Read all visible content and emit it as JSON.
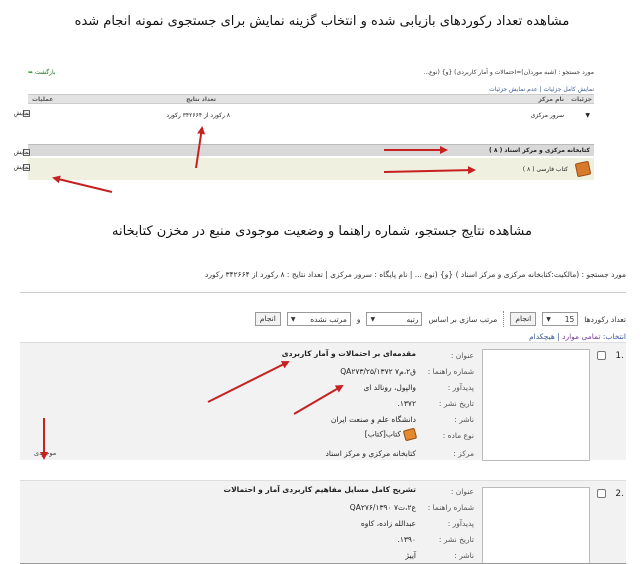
{
  "captions": {
    "top": "مشاهده تعداد رکوردهای بازیابی شده و انتخاب گزینه نمایش برای جستجوی نمونه انجام شده",
    "middle": "مشاهده نتایج جستجو، شماره راهنما و وضعیت موجودی منبع در مخزن کتابخانه"
  },
  "shot1": {
    "query": "مورد جستجو : (شبه مورد(ن)=احتمالات و آمار کاربردی) {و} (نوع...",
    "back": "بازگشت",
    "links": "نمایش کامل جزئیات | عدم نمایش جزئیات",
    "headers": {
      "details": "جزئیات",
      "center_name": "نام مرکز",
      "result_count": "تعداد نتایج",
      "actions": "عملیات"
    },
    "row1": {
      "center": "سرور مرکزی",
      "count": "۸ رکورد از ۳۴۲۶۶۴ رکورد",
      "action": "نمایش"
    },
    "group": {
      "title": "کتابخانه مرکزی و مرکز اسناد ( ۸ )",
      "action": "نمایش"
    },
    "row2": {
      "name": "کتاب فارسی ( ۸ )",
      "action": "نمایش"
    }
  },
  "shot2": {
    "info": "مورد جستجو : (مالکیت:کتابخانه مرکزی و مرکز اسناد ) {و} (نوع ... | نام پایگاه : سرور مرکزی | تعداد نتایج : ۸ رکورد از ۳۴۲۶۶۴ رکورد",
    "controls": {
      "records_label": "تعداد رکوردها",
      "records_value": "15",
      "do_label": "انجام",
      "sort_label": "مرتب سازی بر اساس",
      "sort_value": "رتبه",
      "and_label": "و",
      "order_value": "مرتب نشده",
      "do_label2": "انجام"
    },
    "select": {
      "label": "انتخاب:",
      "all": "تمامی موارد",
      "none": "هیچکدام"
    },
    "labels": {
      "title": "عنوان :",
      "call_no": "شماره راهنما :",
      "author": "پدیدآور :",
      "pub_date": "تاریخ نشر :",
      "publisher": "ناشر :",
      "material": "نوع ماده :",
      "center": "مرکز :"
    },
    "results": [
      {
        "num": ".1",
        "title": "مقدمه‌ای بر احتمالات و آمار کاربردی",
        "call_no": "QA۲۷۳/۲۵/ق۲،م۷ ۱۳۷۲",
        "author": "والپول، رونالد ای",
        "pub_date": "۱۳۷۲.",
        "publisher": "دانشگاه علم و صنعت ایران",
        "material": "کتاب[کتاب]",
        "center": "کتابخانه مرکزی و مرکز اسناد",
        "availability": "موجودی"
      },
      {
        "num": ".2",
        "title": "تشریح کامل مسایل مفاهیم کاربردی آمار و احتمالات",
        "call_no": "QA۲۷۶/ع۲،ت۷ ۱۳۹۰",
        "author": "عبدالله زاده، کاوه",
        "pub_date": "۱۳۹۰.",
        "publisher": "آییژ"
      }
    ]
  },
  "colors": {
    "arrow": "#c62020",
    "link": "#3a5a98",
    "row_bg": "#f2f2f2"
  }
}
